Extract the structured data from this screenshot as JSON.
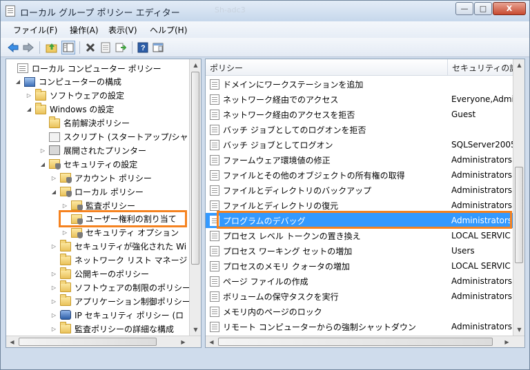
{
  "window": {
    "title": "ローカル グループ ポリシー エディター",
    "title_blur": "Sh-adc3",
    "buttons": {
      "minimize": "—",
      "maximize": "□",
      "close": "X"
    }
  },
  "menu": [
    {
      "id": "file",
      "label": "ファイル(F)"
    },
    {
      "id": "action",
      "label": "操作(A)"
    },
    {
      "id": "view",
      "label": "表示(V)"
    },
    {
      "id": "help",
      "label": "ヘルプ(H)"
    }
  ],
  "toolbar": {
    "icons": [
      "back-arrow-icon",
      "forward-arrow-icon",
      "up-folder-icon",
      "show-hide-tree-icon",
      "delete-icon",
      "properties-icon",
      "export-list-icon",
      "help-icon",
      "console-pane-icon"
    ]
  },
  "tree": [
    {
      "label": "ローカル コンピューター ポリシー",
      "twisty": "",
      "icon": "doc"
    },
    {
      "label": "コンピューターの構成",
      "twisty": "◢",
      "icon": "pc"
    },
    {
      "label": "ソフトウェアの設定",
      "twisty": "▷",
      "icon": "folder"
    },
    {
      "label": "Windows の設定",
      "twisty": "◢",
      "icon": "folder"
    },
    {
      "label": "名前解決ポリシー",
      "twisty": "",
      "icon": "folder"
    },
    {
      "label": "スクリプト (スタートアップ/シャ",
      "twisty": "",
      "icon": "script"
    },
    {
      "label": "展開されたプリンター",
      "twisty": "▷",
      "icon": "printer"
    },
    {
      "label": "セキュリティの設定",
      "twisty": "◢",
      "icon": "shield"
    },
    {
      "label": "アカウント ポリシー",
      "twisty": "▷",
      "icon": "shield"
    },
    {
      "label": "ローカル ポリシー",
      "twisty": "◢",
      "icon": "shield"
    },
    {
      "label": "監査ポリシー",
      "twisty": "▷",
      "icon": "shield"
    },
    {
      "label": "ユーザー権利の割り当て",
      "twisty": "",
      "icon": "shield"
    },
    {
      "label": "セキュリティ オプション",
      "twisty": "▷",
      "icon": "shield"
    },
    {
      "label": "セキュリティが強化された Wi",
      "twisty": "▷",
      "icon": "folder"
    },
    {
      "label": "ネットワーク リスト マネージ",
      "twisty": "",
      "icon": "folder"
    },
    {
      "label": "公開キーのポリシー",
      "twisty": "▷",
      "icon": "folder"
    },
    {
      "label": "ソフトウェアの制限のポリシー",
      "twisty": "▷",
      "icon": "folder"
    },
    {
      "label": "アプリケーション制御ポリシー",
      "twisty": "▷",
      "icon": "folder"
    },
    {
      "label": "IP セキュリティ ポリシー (ロ",
      "twisty": "▷",
      "icon": "ipsec"
    },
    {
      "label": "監査ポリシーの詳細な構成",
      "twisty": "▷",
      "icon": "folder"
    }
  ],
  "list": {
    "headers": {
      "policy": "ポリシー",
      "setting": "セキュリティの設"
    },
    "rows": [
      {
        "policy": "ドメインにワークステーションを追加",
        "setting": ""
      },
      {
        "policy": "ネットワーク経由でのアクセス",
        "setting": "Everyone,Admi"
      },
      {
        "policy": "ネットワーク経由のアクセスを拒否",
        "setting": "Guest"
      },
      {
        "policy": "バッチ ジョブとしてのログオンを拒否",
        "setting": ""
      },
      {
        "policy": "バッチ ジョブとしてログオン",
        "setting": "SQLServer2005"
      },
      {
        "policy": "ファームウェア環境値の修正",
        "setting": "Administrators"
      },
      {
        "policy": "ファイルとその他のオブジェクトの所有権の取得",
        "setting": "Administrators"
      },
      {
        "policy": "ファイルとディレクトリのバックアップ",
        "setting": "Administrators,"
      },
      {
        "policy": "ファイルとディレクトリの復元",
        "setting": "Administrators,"
      },
      {
        "policy": "プログラムのデバッグ",
        "setting": "Administrators"
      },
      {
        "policy": "プロセス レベル トークンの置き換え",
        "setting": "LOCAL SERVIC"
      },
      {
        "policy": "プロセス ワーキング セットの増加",
        "setting": "Users"
      },
      {
        "policy": "プロセスのメモリ クォータの増加",
        "setting": "LOCAL SERVIC"
      },
      {
        "policy": "ページ ファイルの作成",
        "setting": "Administrators"
      },
      {
        "policy": "ボリュームの保守タスクを実行",
        "setting": "Administrators"
      },
      {
        "policy": "メモリ内のページのロック",
        "setting": ""
      },
      {
        "policy": "リモート コンピューターからの強制シャットダウン",
        "setting": "Administrators"
      }
    ],
    "selected_policy": "プログラムのデバッグ"
  },
  "colors": {
    "selection": "#3399ff",
    "highlight": "#f5821f"
  }
}
